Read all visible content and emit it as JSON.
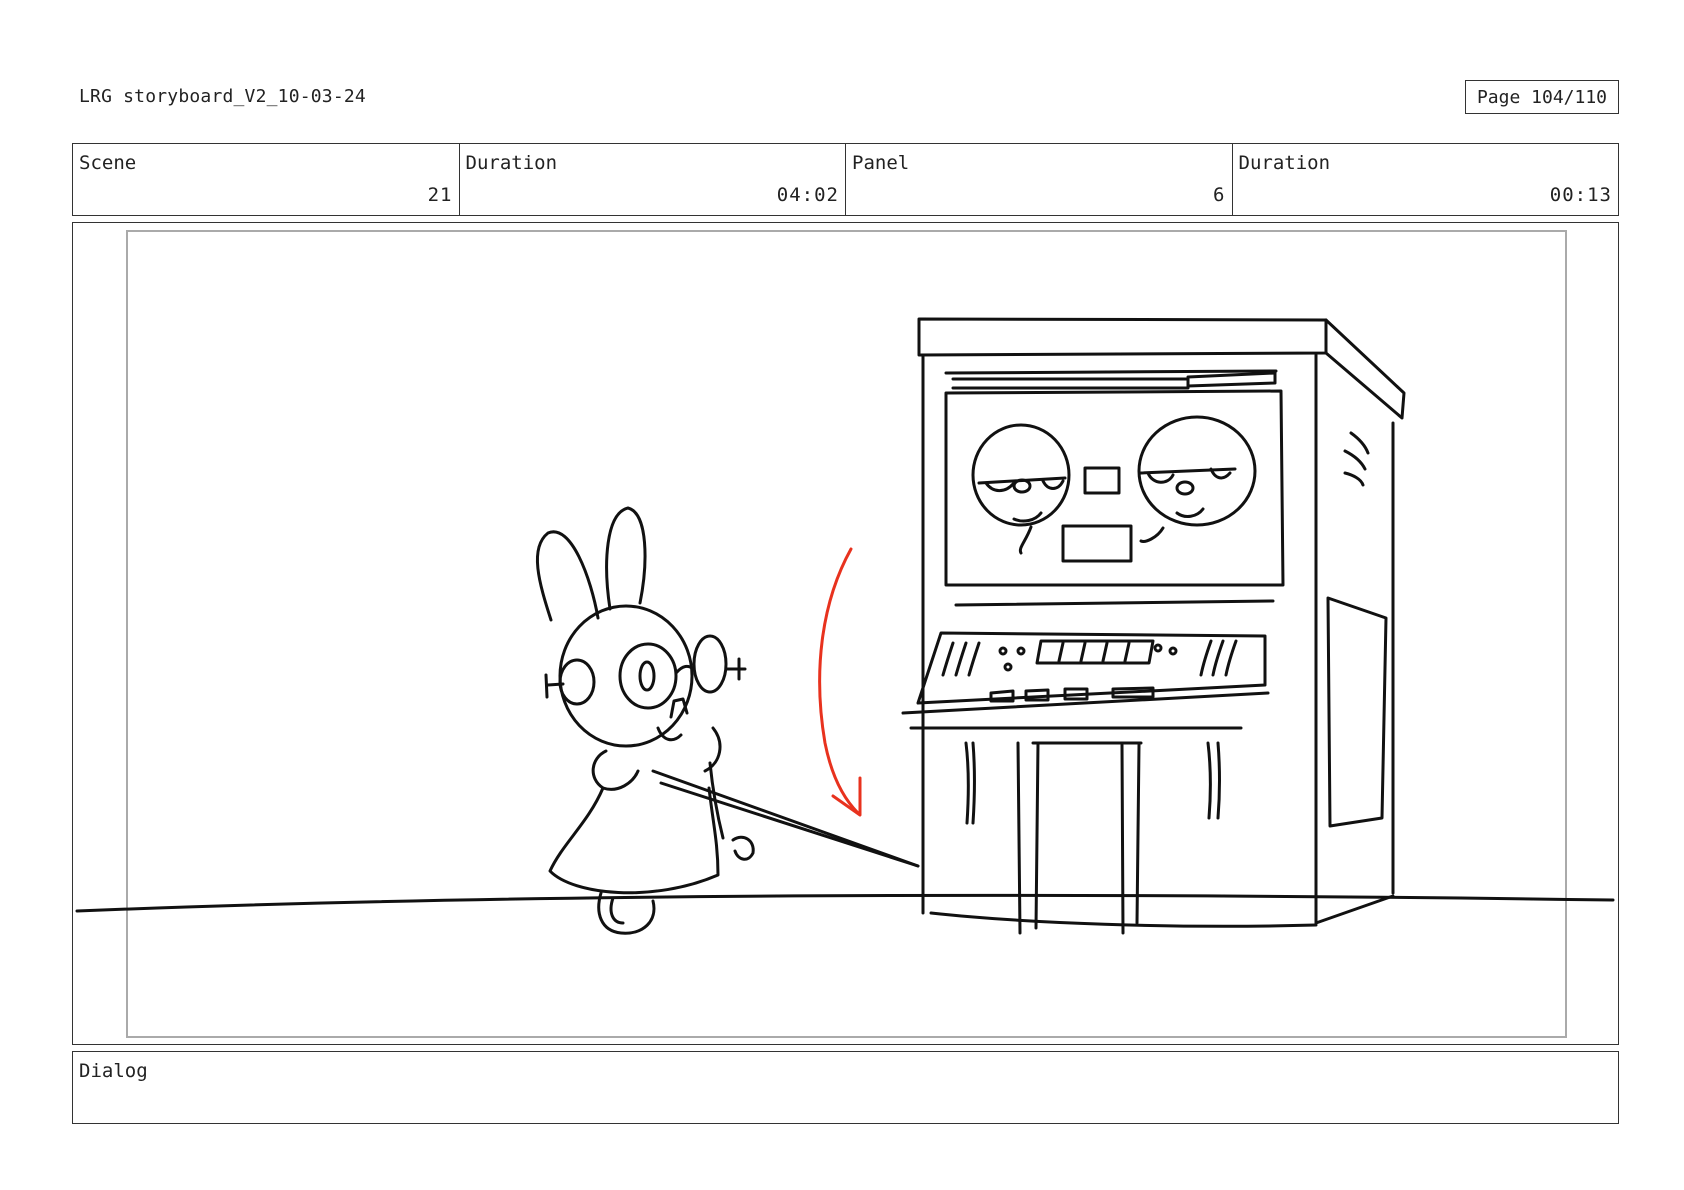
{
  "header": {
    "document_title": "LRG storyboard_V2_10-03-24",
    "page_indicator": "Page 104/110"
  },
  "info": {
    "scene_label": "Scene",
    "scene_value": "21",
    "scene_duration_label": "Duration",
    "scene_duration_value": "04:02",
    "panel_label": "Panel",
    "panel_value": "6",
    "panel_duration_label": "Duration",
    "panel_duration_value": "00:13"
  },
  "dialog": {
    "label": "Dialog",
    "text": ""
  },
  "colors": {
    "ink": "#111111",
    "motion_arrow": "#e8321e",
    "safe_frame": "#aaaaaa"
  }
}
